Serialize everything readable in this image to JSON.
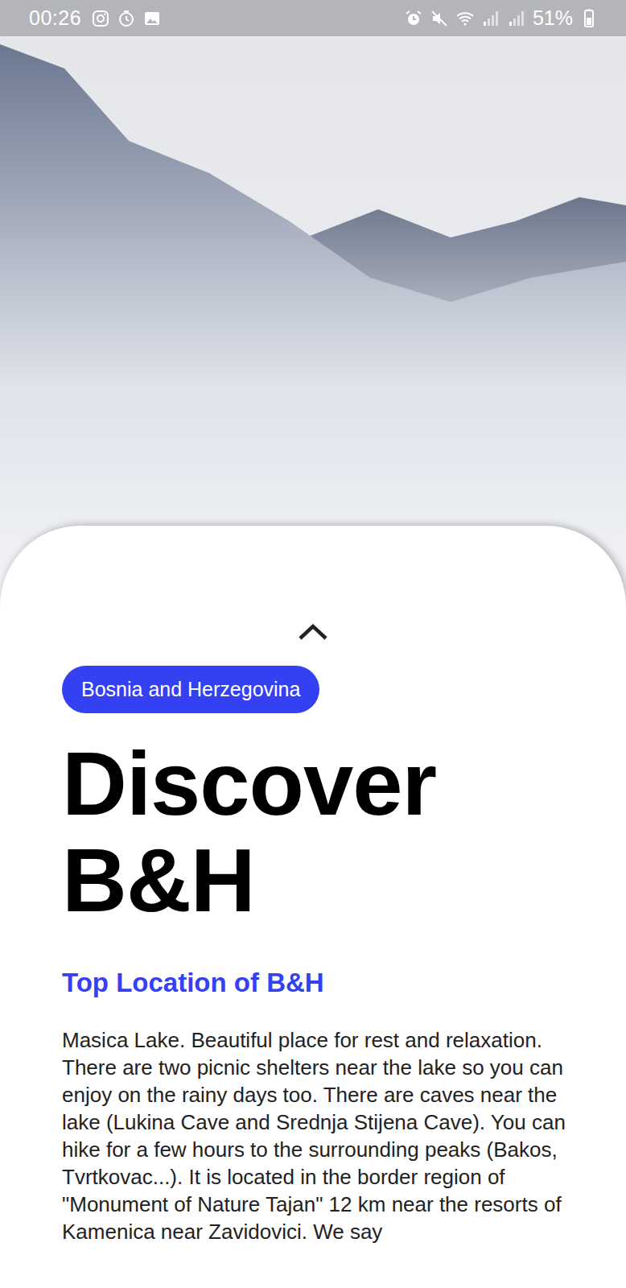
{
  "status_bar": {
    "time": "00:26",
    "battery": "51%"
  },
  "badge": "Bosnia and Herzegovina",
  "title": "Discover B&H",
  "subtitle": "Top Location of B&H",
  "description": "Masica Lake. Beautiful place for rest and relaxation. There are two picnic shelters near the lake so you can enjoy on the rainy days too. There are caves near the lake (Lukina Cave and Srednja Stijena Cave). You can hike for a few hours to the surrounding peaks (Bakos, Tvrtkovac...). It is located in the border region of \"Monument of Nature Tajan\" 12 km near the resorts of Kamenica near Zavidovici. We say"
}
